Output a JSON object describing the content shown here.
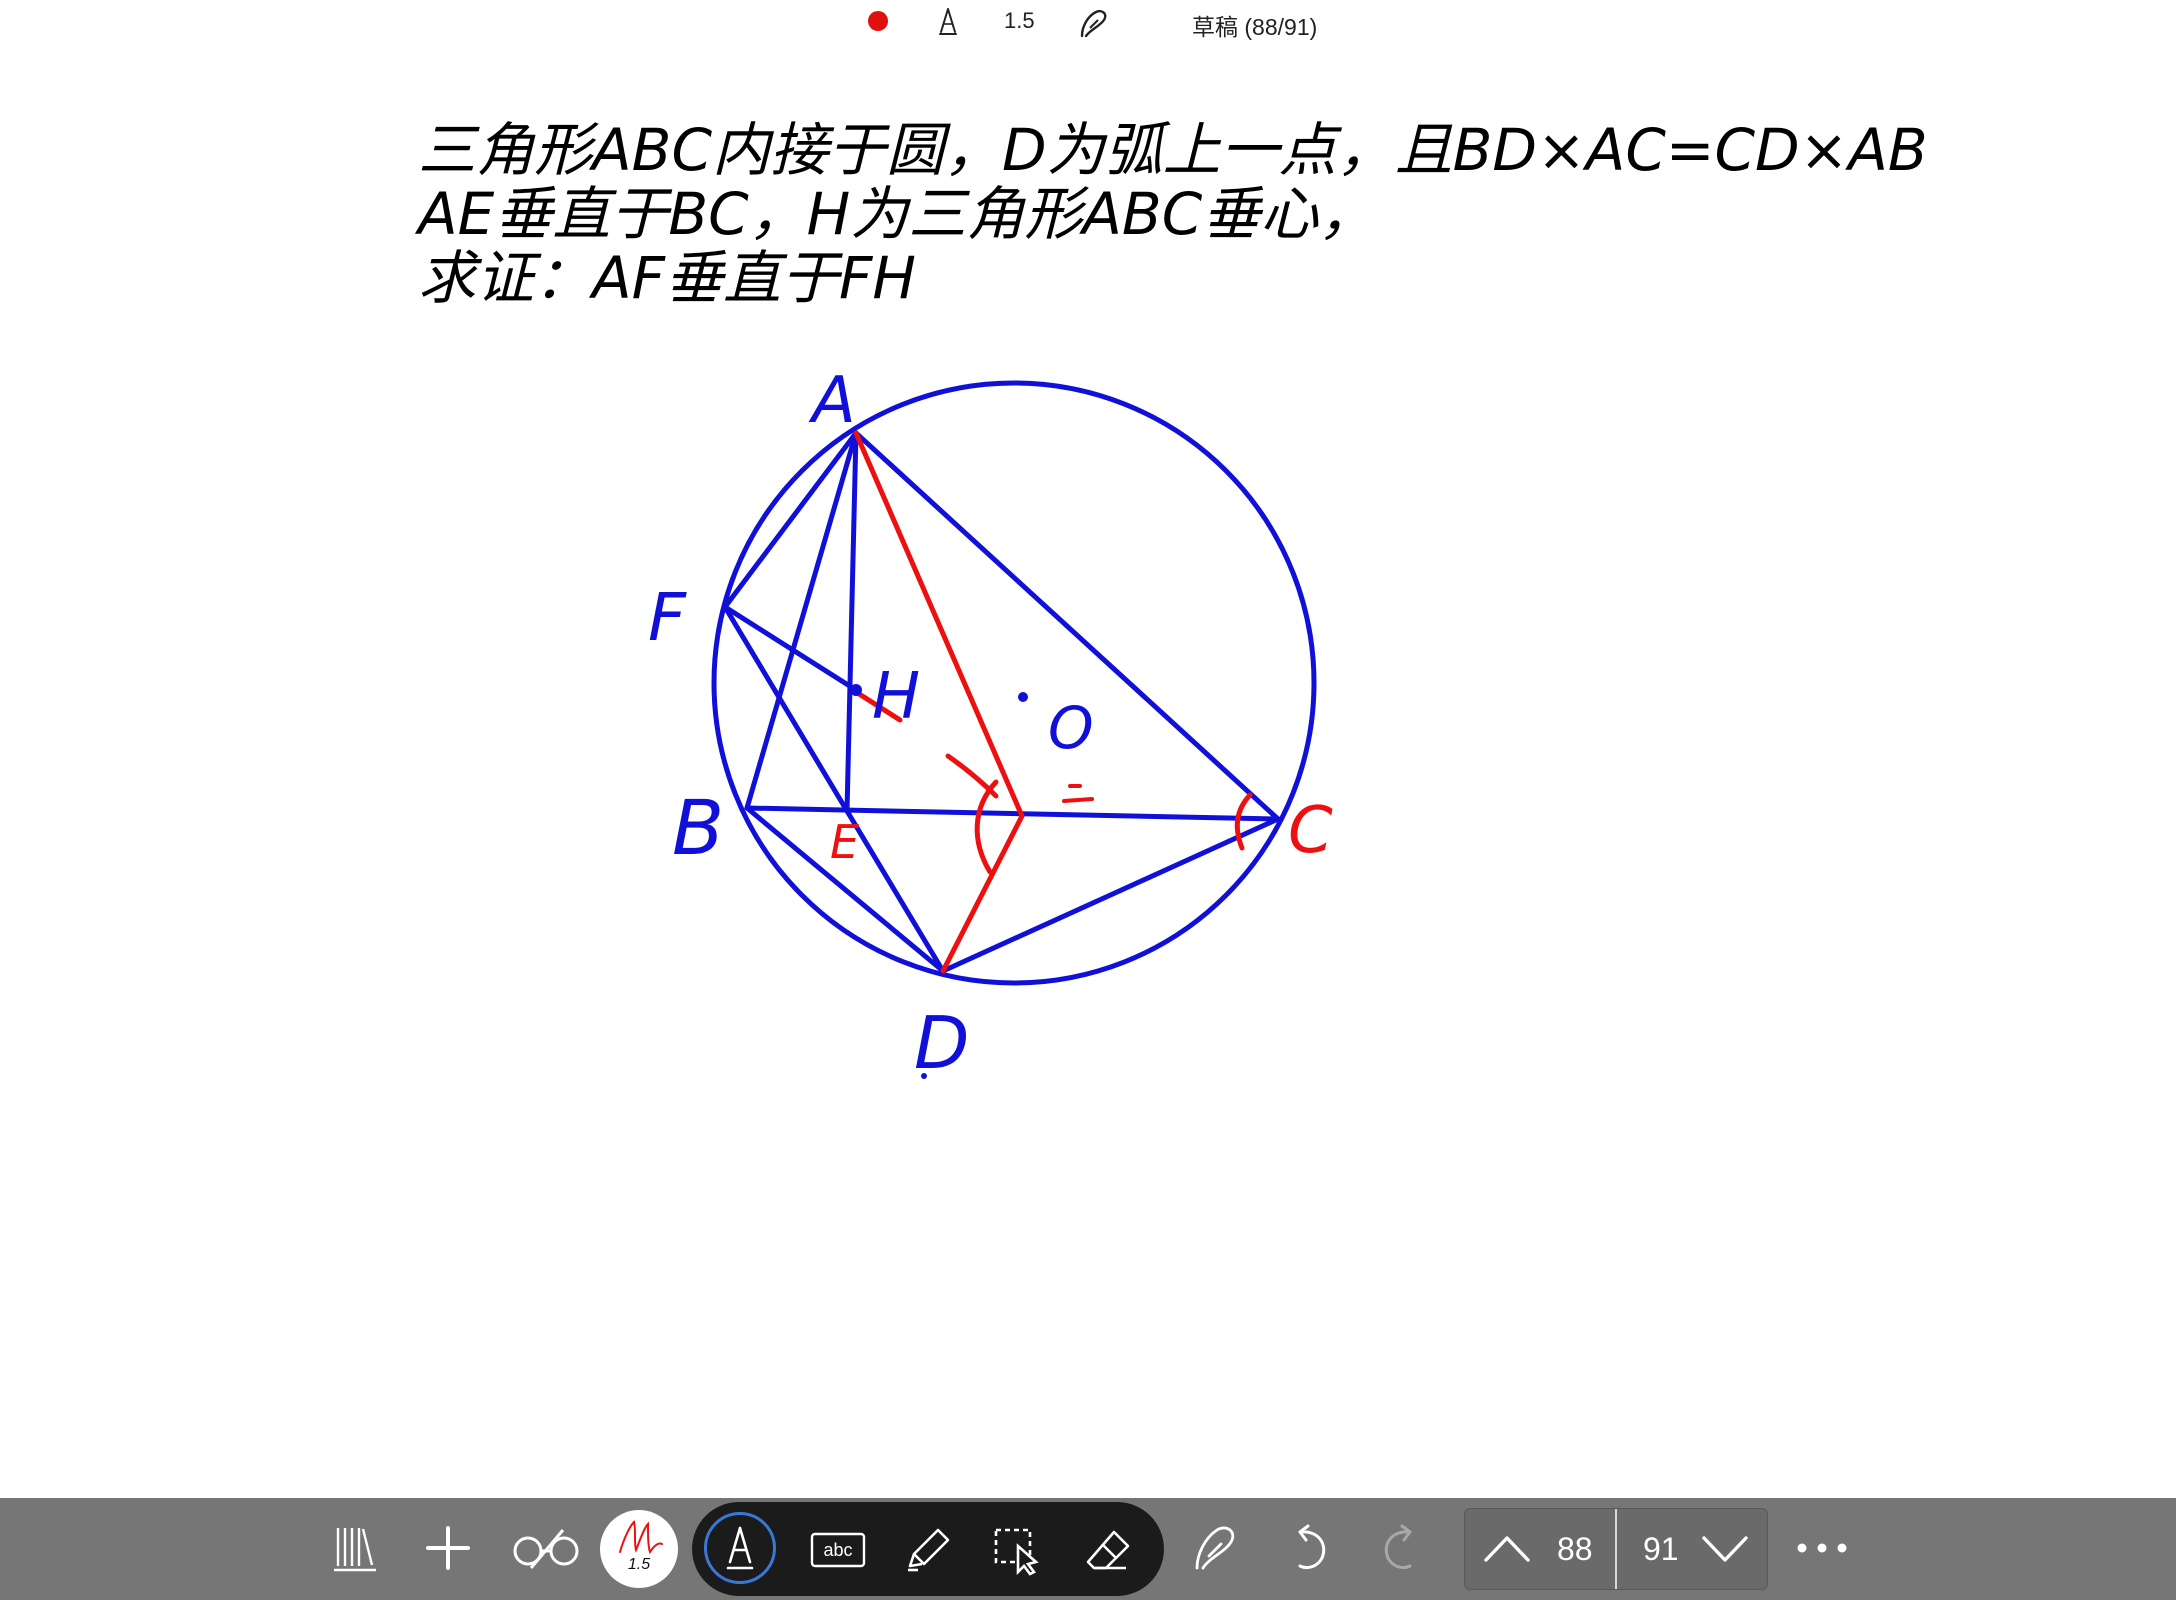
{
  "status_bar": {
    "pen_size": "1.5",
    "document_title": "草稿 (88/91)"
  },
  "problem": {
    "lines": [
      "三角形ABC内接于圆，D为弧上一点，且BD×AC=CD×AB",
      "AE垂直于BC，H为三角形ABC垂心，",
      "求证：AF垂直于FH"
    ]
  },
  "diagram": {
    "labels": {
      "A": "A",
      "F": "F",
      "H": "H",
      "O": "O",
      "B": "B",
      "E": "E",
      "C": "C",
      "D": "D"
    },
    "colors": {
      "construction": "#1010d8",
      "annotation": "#ee1010"
    }
  },
  "toolbar": {
    "icons": [
      "library-icon",
      "add-icon",
      "glasses-icon",
      "pen-preview-icon",
      "pen-icon",
      "text-box-icon",
      "highlighter-icon",
      "lasso-select-icon",
      "eraser-icon",
      "shape-pen-icon",
      "undo-icon",
      "redo-icon",
      "page-up-icon",
      "page-down-icon",
      "more-icon"
    ],
    "pen_preview_size": "1.5",
    "text_tool_label": "abc",
    "current_page": "88",
    "total_pages": "91",
    "more_label": "•••"
  }
}
